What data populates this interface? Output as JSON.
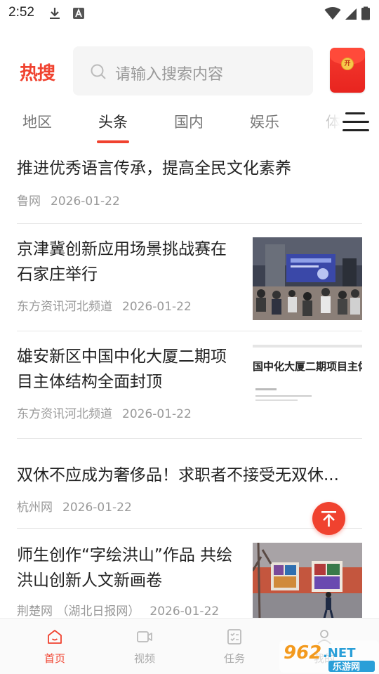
{
  "status_bar": {
    "time": "2:52"
  },
  "header": {
    "logo_text": "热搜",
    "search_placeholder": "请输入搜索内容",
    "redpacket_badge": "开"
  },
  "tabs": [
    {
      "label": "地区",
      "active": false
    },
    {
      "label": "头条",
      "active": true
    },
    {
      "label": "国内",
      "active": false
    },
    {
      "label": "娱乐",
      "active": false
    },
    {
      "label": "体",
      "active": false
    }
  ],
  "news": [
    {
      "title_lines": [
        "推进优秀语言传承，提高全民文化素养"
      ],
      "source": "鲁网",
      "date": "2026-01-22",
      "has_image": false
    },
    {
      "title_lines": [
        "京津冀创新应用场景挑战赛在",
        "石家庄举行"
      ],
      "source": "东方资讯河北频道",
      "date": "2026-01-22",
      "has_image": true,
      "image": "conference-photo"
    },
    {
      "title_lines": [
        "雄安新区中国中化大厦二期项",
        "目主体结构全面封顶"
      ],
      "source": "东方资讯河北频道",
      "date": "2026-01-22",
      "has_image": true,
      "image": "banner-photo",
      "image_text": "国中化大厦二期项目主体"
    },
    {
      "title_lines": [
        "双休不应成为奢侈品！求职者不接受无双休..."
      ],
      "source": "杭州网",
      "date": "2026-01-22",
      "has_image": false
    },
    {
      "title_lines": [
        "师生创作“字绘洪山”作品 共绘",
        "洪山创新人文新画卷"
      ],
      "source": "荆楚网 （湖北日报网）",
      "date": "2026-01-22",
      "has_image": true,
      "image": "artwork-photo"
    }
  ],
  "bottom_nav": [
    {
      "label": "首页",
      "icon": "home-icon",
      "active": true
    },
    {
      "label": "视频",
      "icon": "video-icon",
      "active": false
    },
    {
      "label": "任务",
      "icon": "task-icon",
      "active": false
    },
    {
      "label": "我的",
      "icon": "user-icon",
      "active": false
    }
  ],
  "watermark": {
    "number": "962",
    "suffix": ".NET",
    "subtitle": "乐游网"
  },
  "colors": {
    "accent": "#f0422f",
    "text": "#222222",
    "meta": "#999999"
  }
}
